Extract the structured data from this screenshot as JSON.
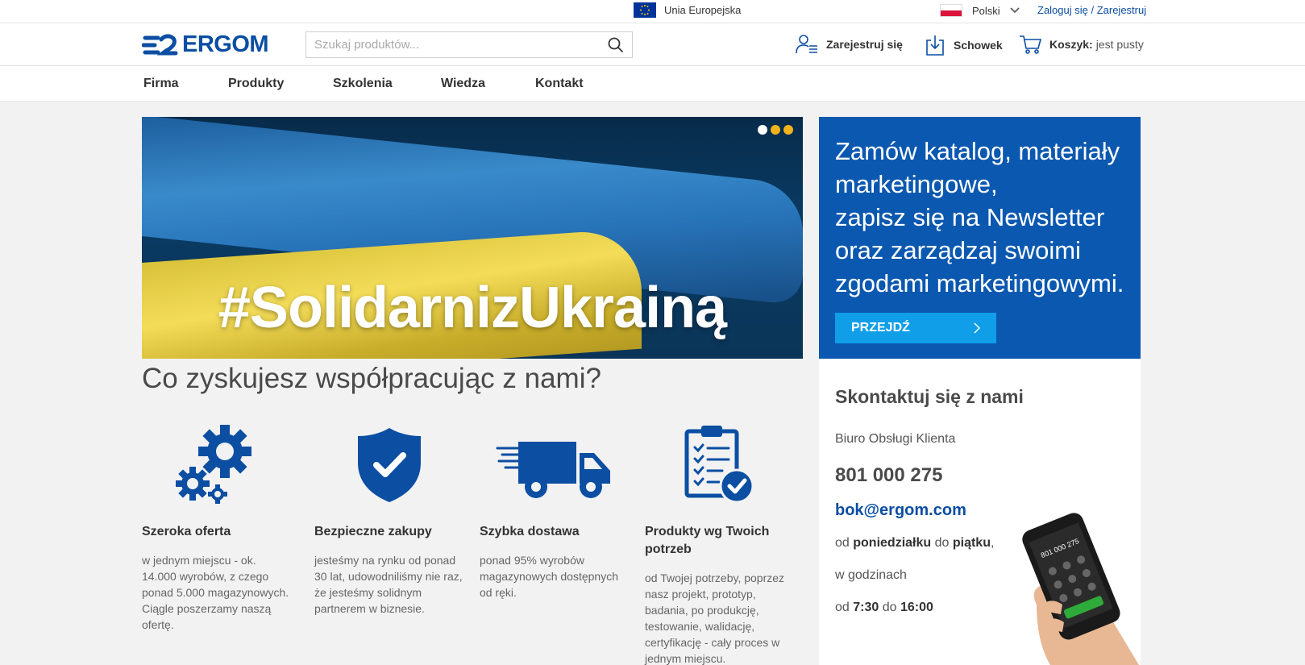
{
  "topbar": {
    "eu_label": "Unia Europejska",
    "language": "Polski",
    "login_link": "Zaloguj się / Zarejestruj"
  },
  "header": {
    "logo_text": "ERGOM",
    "search_placeholder": "Szukaj produktów...",
    "register_label": "Zarejestruj się",
    "clipboard_label": "Schowek",
    "cart_label": "Koszyk:",
    "cart_status": "jest pusty"
  },
  "nav": {
    "items": [
      "Firma",
      "Produkty",
      "Szkolenia",
      "Wiedza",
      "Kontakt"
    ]
  },
  "banner": {
    "title": "#SolidarnizUkrainą",
    "slides_count": 3,
    "active_slide": 1
  },
  "promo": {
    "text": "Zamów katalog, materiały marketingowe,\nzapisz się na Newsletter oraz zarządzaj swoimi zgodami marketingowymi.",
    "button_label": "PRZEJDŹ"
  },
  "benefits": {
    "title": "Co zyskujesz współpracując z nami?",
    "items": [
      {
        "title": "Szeroka oferta",
        "text": "w jednym miejscu - ok. 14.000 wyrobów, z czego ponad 5.000 magazynowych. Ciągle poszerzamy naszą ofertę.",
        "icon": "gears-icon"
      },
      {
        "title": "Bezpieczne zakupy",
        "text": "jesteśmy na rynku od ponad 30 lat, udowodniliśmy nie raz, że jesteśmy solidnym partnerem w biznesie.",
        "icon": "shield-check-icon"
      },
      {
        "title": "Szybka dostawa",
        "text": "ponad 95% wyrobów magazynowych dostępnych od ręki.",
        "icon": "delivery-truck-icon"
      },
      {
        "title": "Produkty wg Twoich potrzeb",
        "text": "od Twojej potrzeby, poprzez nasz projekt, prototyp, badania, po produkcję, testowanie, walidację, certyfikację - cały proces w jednym miejscu.",
        "icon": "clipboard-checklist-icon"
      }
    ]
  },
  "contact": {
    "title": "Skontaktuj się z nami",
    "label": "Biuro Obsługi Klienta",
    "phone": "801 000 275",
    "email": "bok@ergom.com",
    "days_prefix": "od",
    "days_from": "poniedziałku",
    "days_mid": "do",
    "days_to": "piątku",
    "days_suffix": ",",
    "hours_label": "w godzinach",
    "hours_prefix": "od",
    "hours_from": "7:30",
    "hours_mid": "do",
    "hours_to": "16:00",
    "phone_screen_text": "801 000 275"
  },
  "colors": {
    "brand_blue": "#0b4ea2",
    "promo_blue": "#0b58b0",
    "button_blue": "#0f9ee7",
    "dot_yellow": "#f1b21c"
  }
}
